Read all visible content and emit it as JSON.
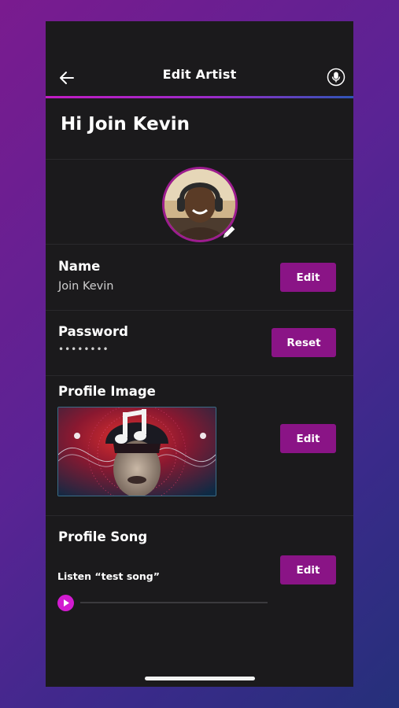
{
  "header": {
    "title": "Edit Artist",
    "back_icon": "back-arrow-icon",
    "mic_icon": "microphone-icon"
  },
  "greeting": "Hi Join Kevin",
  "name_row": {
    "label": "Name",
    "value": "Join Kevin",
    "button": "Edit"
  },
  "password_row": {
    "label": "Password",
    "value": "••••••••",
    "button": "Reset"
  },
  "profile_image_row": {
    "label": "Profile Image",
    "button": "Edit"
  },
  "profile_song_row": {
    "label": "Profile Song",
    "listen_text": "Listen “test song”",
    "button": "Edit",
    "progress": 0
  },
  "colors": {
    "accent": "#8a1486",
    "background": "#1b1a1c",
    "play": "#d21bd0"
  }
}
